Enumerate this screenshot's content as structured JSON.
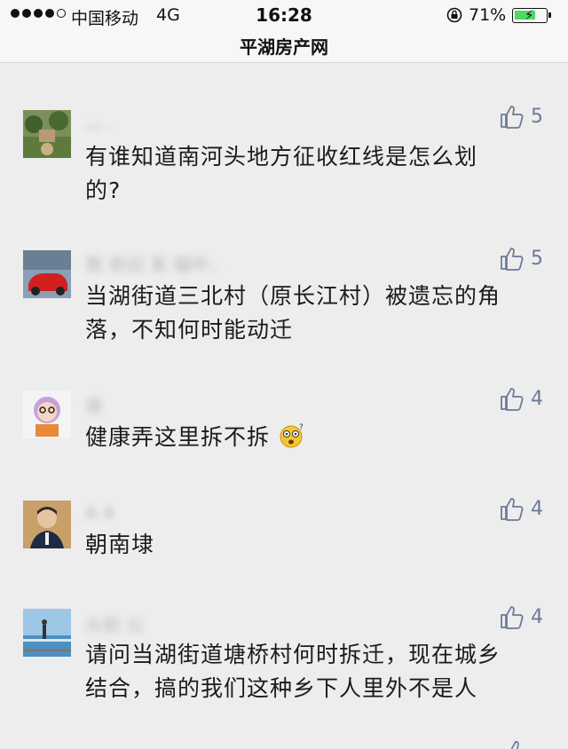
{
  "status": {
    "carrier": "中国移动",
    "network": "4G",
    "time": "16:28",
    "battery": "71%",
    "battery_level": 0.71
  },
  "nav": {
    "title": "平湖房产网"
  },
  "comments": [
    {
      "nickname": "一 ·",
      "likes": "5",
      "text_line1": "有谁知道南河头地方征收红线是怎么划",
      "text_line2": "的?"
    },
    {
      "nickname": "我 依旧 发 福中..",
      "likes": "5",
      "text_line1": "当湖街道三北村（原长江村）被遗忘的角",
      "text_line2": "落，不知何时能动迁"
    },
    {
      "nickname": "夜",
      "likes": "4",
      "text": "健康弄这里拆不拆"
    },
    {
      "nickname": "A 4",
      "likes": "4",
      "text": "朝南埭"
    },
    {
      "nickname": "从前 公",
      "likes": "4",
      "text_line1": "请问当湖街道塘桥村何时拆迁，现在城乡",
      "text_line2": "结合，搞的我们这种乡下人里外不是人"
    }
  ],
  "colors": {
    "background": "#ededed",
    "like_color": "#6b7a99",
    "battery_green": "#4cd964"
  },
  "icons": [
    "thumbs-up-icon",
    "lock-rotation-icon",
    "battery-icon",
    "dizzy-face-emoji"
  ]
}
